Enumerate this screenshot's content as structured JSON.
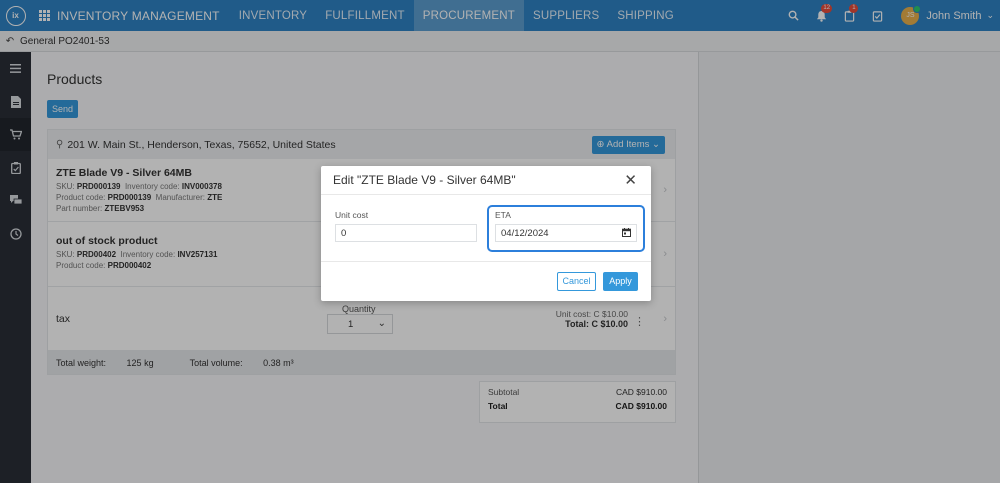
{
  "topnav": {
    "logo_text": "ix",
    "app_title": "INVENTORY MANAGEMENT",
    "items": [
      "INVENTORY",
      "FULFILLMENT",
      "PROCUREMENT",
      "SUPPLIERS",
      "SHIPPING"
    ],
    "active_item": "PROCUREMENT",
    "notifications_badge": "12",
    "tasks_badge": "1",
    "user_initials": "JS",
    "user_name": "John Smith"
  },
  "breadcrumb": {
    "text": "General PO2401-53"
  },
  "sidebar": {
    "icons": [
      "menu-icon",
      "document-icon",
      "cart-icon",
      "clipboard-icon",
      "chat-icon",
      "clock-icon"
    ]
  },
  "main": {
    "title": "Products",
    "send_label": "Send",
    "address": "201 W. Main St., Henderson, Texas, 75652, United States",
    "add_items_label": "Add Items",
    "products": [
      {
        "name": "ZTE Blade V9 - Silver 64MB",
        "sku_label": "SKU:",
        "sku": "PRD000139",
        "inv_label": "Inventory code:",
        "inv": "INV000378",
        "pc_label": "Product code:",
        "pc": "PRD000139",
        "mfr_label": "Manufacturer:",
        "mfr": "ZTE",
        "pn_label": "Part number:",
        "pn": "ZTEBV953"
      },
      {
        "name": "out of stock product",
        "sku_label": "SKU:",
        "sku": "PRD00402",
        "inv_label": "Inventory code:",
        "inv": "INV257131",
        "pc_label": "Product code:",
        "pc": "PRD000402"
      }
    ],
    "tax": {
      "name": "tax",
      "quantity_label": "Quantity",
      "quantity": "1",
      "unit_cost_label": "Unit cost:",
      "unit_cost": "C $10.00",
      "total_label": "Total:",
      "total": "C $10.00"
    },
    "summary": {
      "weight_label": "Total weight:",
      "weight": "125 kg",
      "volume_label": "Total volume:",
      "volume": "0.38 m³"
    },
    "totals": {
      "subtotal_label": "Subtotal",
      "subtotal": "CAD $910.00",
      "total_label": "Total",
      "total": "CAD $910.00"
    }
  },
  "modal": {
    "title": "Edit \"ZTE Blade V9 - Silver 64MB\"",
    "unit_cost_label": "Unit cost",
    "unit_cost_value": "0",
    "eta_label": "ETA",
    "eta_value": "04/12/2024",
    "cancel_label": "Cancel",
    "apply_label": "Apply"
  },
  "colors": {
    "primary": "#2f83c4",
    "accent": "#3498db",
    "focus": "#2c7fdb",
    "sidebar": "#2a2f37"
  }
}
